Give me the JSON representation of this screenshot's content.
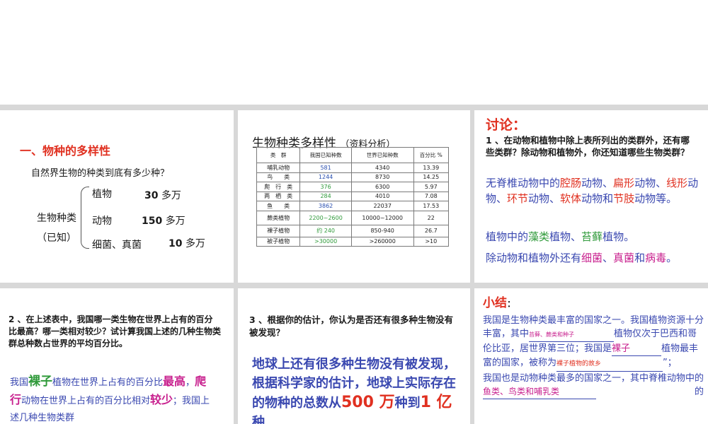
{
  "panel1": {
    "heading": "一、物种的多样性",
    "question": "自然界生物的种类到底有多少种？",
    "label_line1": "生物种类",
    "label_line2": "（已知）",
    "rows": [
      {
        "name": "植物",
        "value": "30",
        "unit": "多万"
      },
      {
        "name": "动物",
        "value": "150",
        "unit": "多万"
      },
      {
        "name": "细菌、真菌",
        "value": "10",
        "unit": "多万"
      }
    ]
  },
  "panel2": {
    "title": "生物种类多样性",
    "subtitle": "（资料分析）",
    "table": {
      "headers": [
        "类　群",
        "我国已知种数",
        "世界已知种数",
        "百分比 %"
      ],
      "rows": [
        [
          "哺乳动物",
          "581",
          "4340",
          "13.39"
        ],
        [
          "鸟　　类",
          "1244",
          "8730",
          "14.25"
        ],
        [
          "爬　行　类",
          "376",
          "6300",
          "5.97"
        ],
        [
          "两　栖　类",
          "284",
          "4010",
          "7.08"
        ],
        [
          "鱼　　类",
          "3862",
          "22037",
          "17.53"
        ],
        [
          "蕨类植物",
          "2200~2600",
          "10000~12000",
          "22"
        ],
        [
          "裸子植物",
          "约 240",
          "850-940",
          "26.7"
        ],
        [
          "被子植物",
          ">30000",
          ">260000",
          ">10"
        ]
      ]
    }
  },
  "panel3": {
    "heading": "讨论：",
    "question": "1 、在动物和植物中除上表所列出的类群外，还有哪些类群？除动物和植物外，你还知道哪些生物类群？",
    "a1": [
      "无脊椎动物中的",
      "腔肠",
      "动物、",
      "扁形",
      "动物、",
      "线形",
      "动物、",
      "环节",
      "动物、",
      "软体",
      "动物和",
      "节肢",
      "动物等。"
    ],
    "a2": [
      "植物中的",
      "藻类",
      "植物、",
      "苔藓",
      "植物。"
    ],
    "a3": [
      "除动物和植物外还有",
      "细菌",
      "、",
      "真菌",
      "和",
      "病毒",
      "。"
    ]
  },
  "panel4": {
    "question": "2 、在上述表中，我国哪一类生物在世界上占有的百分比最高？哪一类相对较少？试计算我国上述的几种生物类群总种数占世界的平均百分比。",
    "a": [
      "我国",
      "裸子",
      "植物在世界上占有的百分比",
      "最高",
      "，",
      "爬行",
      "动物在世界上占有的百分比相对",
      "较少",
      "；我国上述几种生物类群"
    ]
  },
  "panel5": {
    "question": "3 、根据你的估计，你认为是否还有很多种生物没有被发现？",
    "answer_start": "地球上还有很多种生物没有被发现，根据科学家的估计，地球上实际存在的物种的总数从",
    "n1": "500 万",
    "mid": "种到",
    "n2": "1 亿",
    "end": "种"
  },
  "panel6": {
    "heading": "小结",
    "colon": "：",
    "p1a": "我国是生物种类最丰富的国家之一。我国植物资源十分丰富，其中",
    "fill1": "苔藓、蕨类和种子",
    "p1b": "植物仅次于巴西和哥伦比亚，居世界第三位；我国是",
    "fill2": "裸子",
    "p1c": "植物最丰富的国家，被称为",
    "fill3": "裸子植物的故乡",
    "p1d": "”；",
    "p2": "我国也是动物种类最多的国家之一，其中脊椎动物中的",
    "fill4": "鱼类、鸟类和哺乳类",
    "tail": "的"
  }
}
